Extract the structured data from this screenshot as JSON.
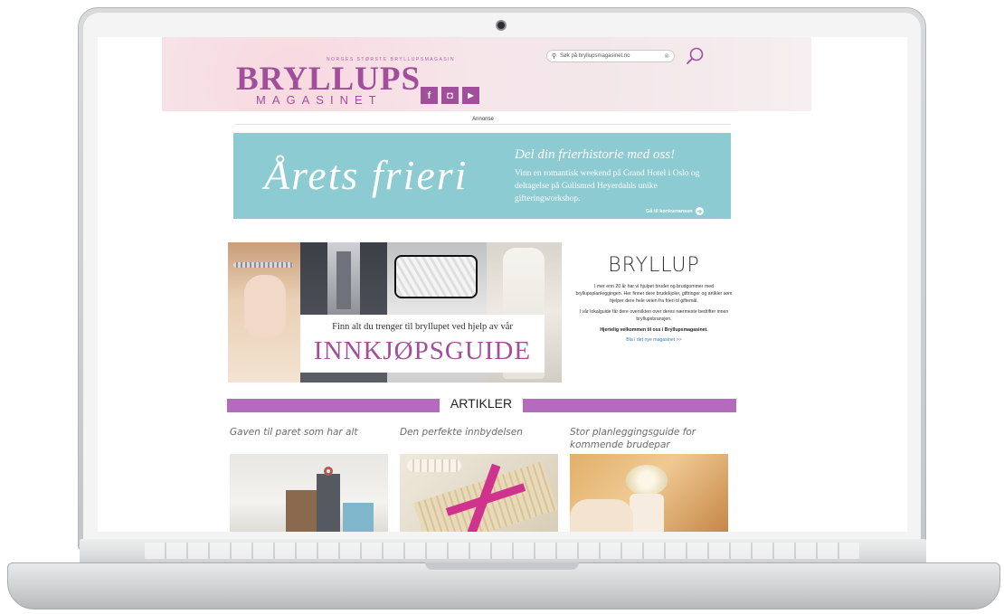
{
  "site": {
    "tagline": "NORGES STØRSTE BRYLLUPSMAGASIN",
    "logo_main": "BRYLLUPS",
    "logo_sub": "MAGASINET",
    "social": [
      {
        "icon": "facebook-icon",
        "glyph": "f"
      },
      {
        "icon": "instagram-icon",
        "glyph": "◘"
      },
      {
        "icon": "youtube-icon",
        "glyph": "▶"
      }
    ],
    "search_placeholder": "Søk på bryllupsmagasinet.no",
    "accent_color": "#a24f9b",
    "bar_color": "#b46bbd",
    "banner_color": "#8ccbd1"
  },
  "ad": {
    "label": "Annonse",
    "title": "Årets frieri",
    "headline": "Del din frierhistorie med oss!",
    "text": "Vinn en romantisk weekend på Grand Hotel i Oslo og deltagelse på Gullsmed Heyerdahls unike gifteringworkshop.",
    "link": "Gå til konkurransen"
  },
  "guide": {
    "line": "Finn alt du trenger til bryllupet ved hjelp av vår",
    "big": "INNKJØPSGUIDE"
  },
  "bryllup": {
    "title": "BRYLLUP",
    "p1": "I mer enn 20 år har vi hjulpet bruder og brudgommer med bryllupsplanleggingen. Her finner dere brudekjoler, giftringer og artikler som hjelper dere hele veien fra frieri til giftemål.",
    "p2": "I vår lokalguide får dere oversikten over deres nærmeste bedrifter innen bryllupsbransjen.",
    "bold": "Hjertelig velkommen til oss i Bryllupsmagasinet.",
    "link": "Bla i det nye magasinet >>"
  },
  "articles": {
    "heading": "ARTIKLER",
    "items": [
      {
        "title": "Gaven til paret som har alt"
      },
      {
        "title": "Den perfekte innbydelsen"
      },
      {
        "title": "Stor planleggingsguide for kommende brudepar"
      }
    ]
  }
}
